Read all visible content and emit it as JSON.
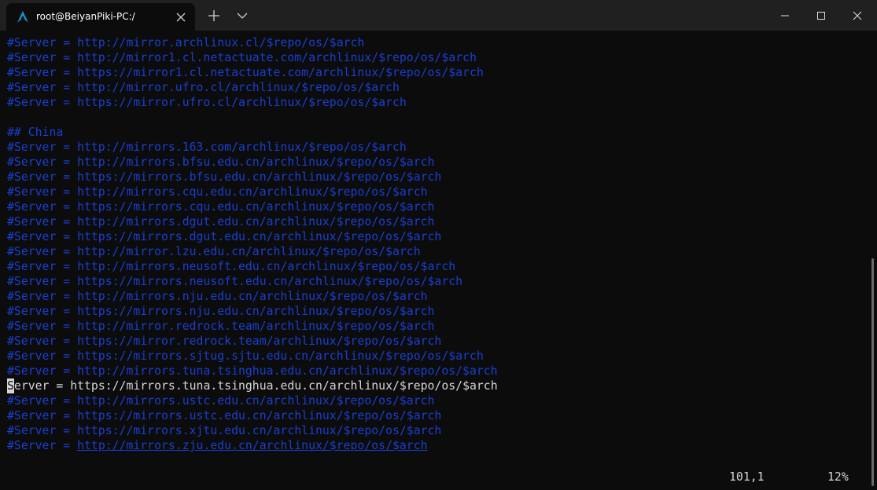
{
  "window": {
    "tab_title": "root@BeiyanPiki-PC:/",
    "icons": {
      "tab": "arch-linux-icon",
      "close_tab": "close-icon",
      "new_tab": "plus-icon",
      "dropdown": "chevron-down-icon",
      "minimize": "minimize-icon",
      "maximize": "maximize-icon",
      "close_window": "close-icon"
    }
  },
  "terminal": {
    "colors": {
      "background": "#0c0c0c",
      "comment": "#1a3fd0",
      "text": "#d6d6d6"
    },
    "lines": [
      {
        "text": "#Server = http://mirror.archlinux.cl/$repo/os/$arch",
        "kind": "comment"
      },
      {
        "text": "#Server = http://mirror1.cl.netactuate.com/archlinux/$repo/os/$arch",
        "kind": "comment"
      },
      {
        "text": "#Server = https://mirror1.cl.netactuate.com/archlinux/$repo/os/$arch",
        "kind": "comment"
      },
      {
        "text": "#Server = http://mirror.ufro.cl/archlinux/$repo/os/$arch",
        "kind": "comment"
      },
      {
        "text": "#Server = https://mirror.ufro.cl/archlinux/$repo/os/$arch",
        "kind": "comment"
      },
      {
        "text": "",
        "kind": "blank"
      },
      {
        "text": "## China",
        "kind": "comment"
      },
      {
        "text": "#Server = http://mirrors.163.com/archlinux/$repo/os/$arch",
        "kind": "comment"
      },
      {
        "text": "#Server = http://mirrors.bfsu.edu.cn/archlinux/$repo/os/$arch",
        "kind": "comment"
      },
      {
        "text": "#Server = https://mirrors.bfsu.edu.cn/archlinux/$repo/os/$arch",
        "kind": "comment"
      },
      {
        "text": "#Server = http://mirrors.cqu.edu.cn/archlinux/$repo/os/$arch",
        "kind": "comment"
      },
      {
        "text": "#Server = https://mirrors.cqu.edu.cn/archlinux/$repo/os/$arch",
        "kind": "comment"
      },
      {
        "text": "#Server = http://mirrors.dgut.edu.cn/archlinux/$repo/os/$arch",
        "kind": "comment"
      },
      {
        "text": "#Server = https://mirrors.dgut.edu.cn/archlinux/$repo/os/$arch",
        "kind": "comment"
      },
      {
        "text": "#Server = http://mirror.lzu.edu.cn/archlinux/$repo/os/$arch",
        "kind": "comment"
      },
      {
        "text": "#Server = http://mirrors.neusoft.edu.cn/archlinux/$repo/os/$arch",
        "kind": "comment"
      },
      {
        "text": "#Server = https://mirrors.neusoft.edu.cn/archlinux/$repo/os/$arch",
        "kind": "comment"
      },
      {
        "text": "#Server = http://mirrors.nju.edu.cn/archlinux/$repo/os/$arch",
        "kind": "comment"
      },
      {
        "text": "#Server = https://mirrors.nju.edu.cn/archlinux/$repo/os/$arch",
        "kind": "comment"
      },
      {
        "text": "#Server = http://mirror.redrock.team/archlinux/$repo/os/$arch",
        "kind": "comment"
      },
      {
        "text": "#Server = https://mirror.redrock.team/archlinux/$repo/os/$arch",
        "kind": "comment"
      },
      {
        "text": "#Server = https://mirrors.sjtug.sjtu.edu.cn/archlinux/$repo/os/$arch",
        "kind": "comment"
      },
      {
        "text": "#Server = http://mirrors.tuna.tsinghua.edu.cn/archlinux/$repo/os/$arch",
        "kind": "comment"
      },
      {
        "text": "Server = https://mirrors.tuna.tsinghua.edu.cn/archlinux/$repo/os/$arch",
        "kind": "active"
      },
      {
        "text": "#Server = http://mirrors.ustc.edu.cn/archlinux/$repo/os/$arch",
        "kind": "comment"
      },
      {
        "text": "#Server = https://mirrors.ustc.edu.cn/archlinux/$repo/os/$arch",
        "kind": "comment"
      },
      {
        "text": "#Server = https://mirrors.xjtu.edu.cn/archlinux/$repo/os/$arch",
        "kind": "comment"
      },
      {
        "text": "#Server = http://mirrors.zju.edu.cn/archlinux/$repo/os/$arch",
        "kind": "comment-link"
      }
    ],
    "cursor_line": 23,
    "link_prefix": "#Server = ",
    "status": {
      "position": "101,1",
      "percent": "12%"
    }
  }
}
